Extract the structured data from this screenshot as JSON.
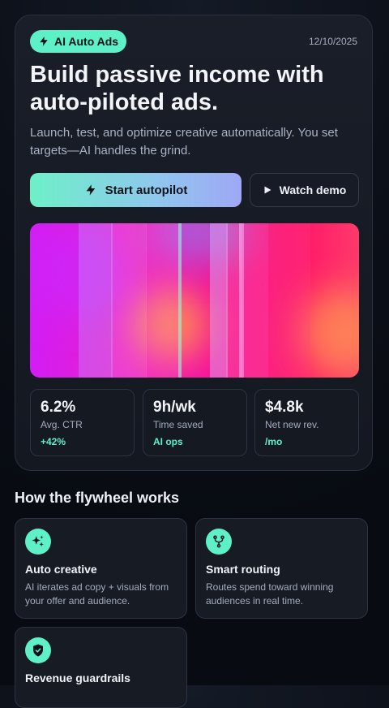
{
  "hero": {
    "badge": "AI Auto Ads",
    "date": "12/10/2025",
    "headline": "Build passive income with auto-piloted ads.",
    "subtitle": "Launch, test, and optimize creative automatically. You set targets—AI handles the grind.",
    "primary_cta": "Start autopilot",
    "secondary_cta": "Watch demo",
    "accent_color": "#5ef0c6"
  },
  "stats": [
    {
      "value": "6.2%",
      "label": "Avg. CTR",
      "delta": "+42%"
    },
    {
      "value": "9h/wk",
      "label": "Time saved",
      "delta": "AI ops"
    },
    {
      "value": "$4.8k",
      "label": "Net new rev.",
      "delta": "/mo"
    }
  ],
  "features_section": {
    "title": "How the flywheel works",
    "items": [
      {
        "icon": "sparkles-icon",
        "title": "Auto creative",
        "desc": "AI iterates ad copy + visuals from your offer and audience."
      },
      {
        "icon": "fork-icon",
        "title": "Smart routing",
        "desc": "Routes spend toward winning audiences in real time."
      },
      {
        "icon": "shield-check-icon",
        "title": "Revenue guardrails",
        "desc": ""
      }
    ]
  }
}
